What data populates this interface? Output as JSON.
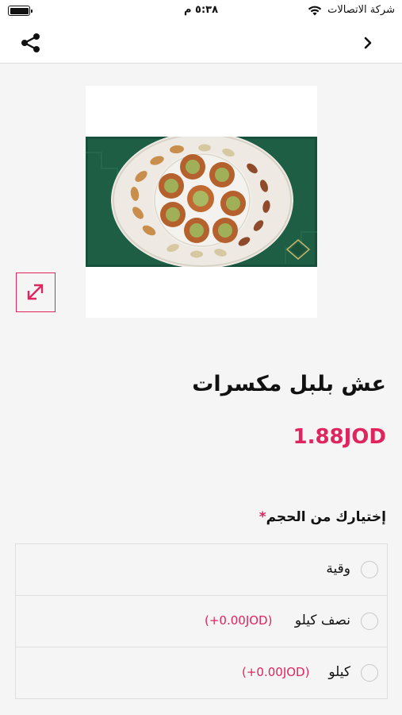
{
  "status_bar": {
    "carrier": "شركة الاتصالات",
    "time": "٥:٣٨ م",
    "battery_level": 1.0
  },
  "navbar": {
    "back_icon": "chevron-right-icon",
    "share_icon": "share-icon"
  },
  "product": {
    "image": "nut-pastry-plate-photo",
    "expand_icon": "expand-arrows-icon",
    "title": "عش بلبل مكسرات",
    "price": "1.88JOD"
  },
  "options": {
    "heading": "إختيارك من الحجم",
    "required_mark": "*",
    "items": [
      {
        "label": "وقية",
        "extra": "",
        "selected": false
      },
      {
        "label": "نصف كيلو",
        "extra": "(+0.00JOD)",
        "selected": false
      },
      {
        "label": "كيلو",
        "extra": "(+0.00JOD)",
        "selected": false
      }
    ]
  },
  "colors": {
    "accent": "#e0245e",
    "background": "#f5f5f5",
    "photo_backdrop": "#1e5e44"
  }
}
